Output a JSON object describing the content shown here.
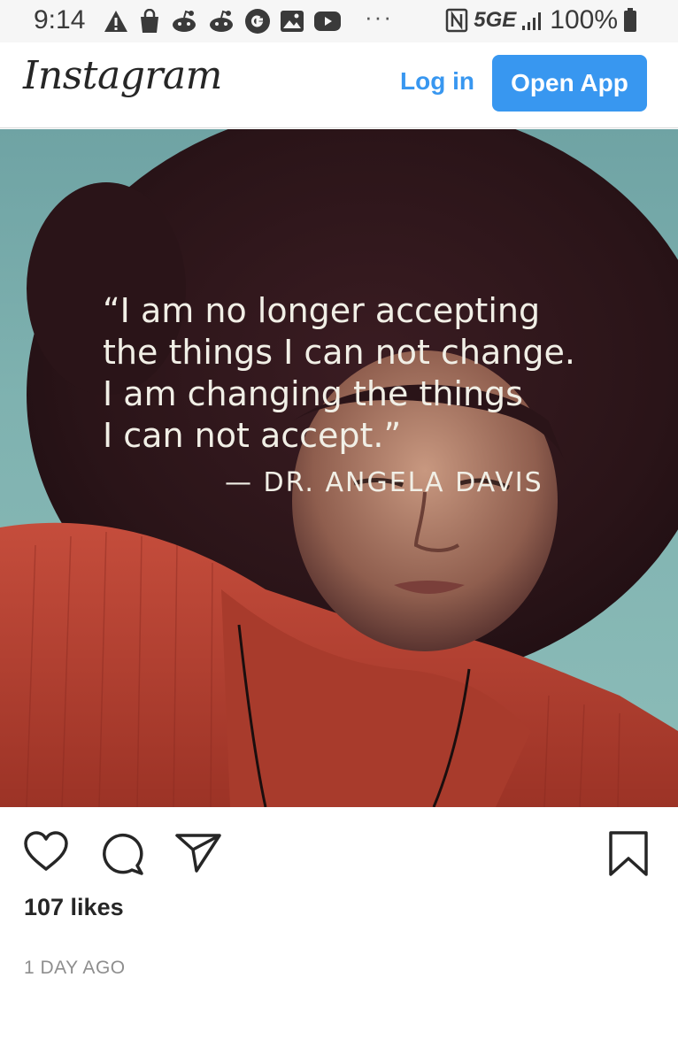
{
  "status_bar": {
    "time": "9:14",
    "left_icons": [
      "warning-icon",
      "shopping-bag-icon",
      "reddit-icon",
      "reddit-icon",
      "google-icon",
      "gallery-icon",
      "youtube-icon"
    ],
    "overflow": "···",
    "nfc_icon": "nfc-icon",
    "network": "5GE",
    "battery": "100%"
  },
  "header": {
    "logo": "Instagram",
    "login_label": "Log in",
    "open_app_label": "Open App",
    "accent_color": "#3897f0"
  },
  "post": {
    "quote_lines": [
      "“I am no longer accepting",
      "the things I can not change.",
      "I am changing the things",
      "I can not accept.”"
    ],
    "author": "— DR. ANGELA DAVIS",
    "likes": "107 likes",
    "time_ago": "1 DAY AGO"
  },
  "actions": {
    "like_icon": "heart-icon",
    "comment_icon": "comment-icon",
    "share_icon": "send-icon",
    "save_icon": "bookmark-icon"
  }
}
